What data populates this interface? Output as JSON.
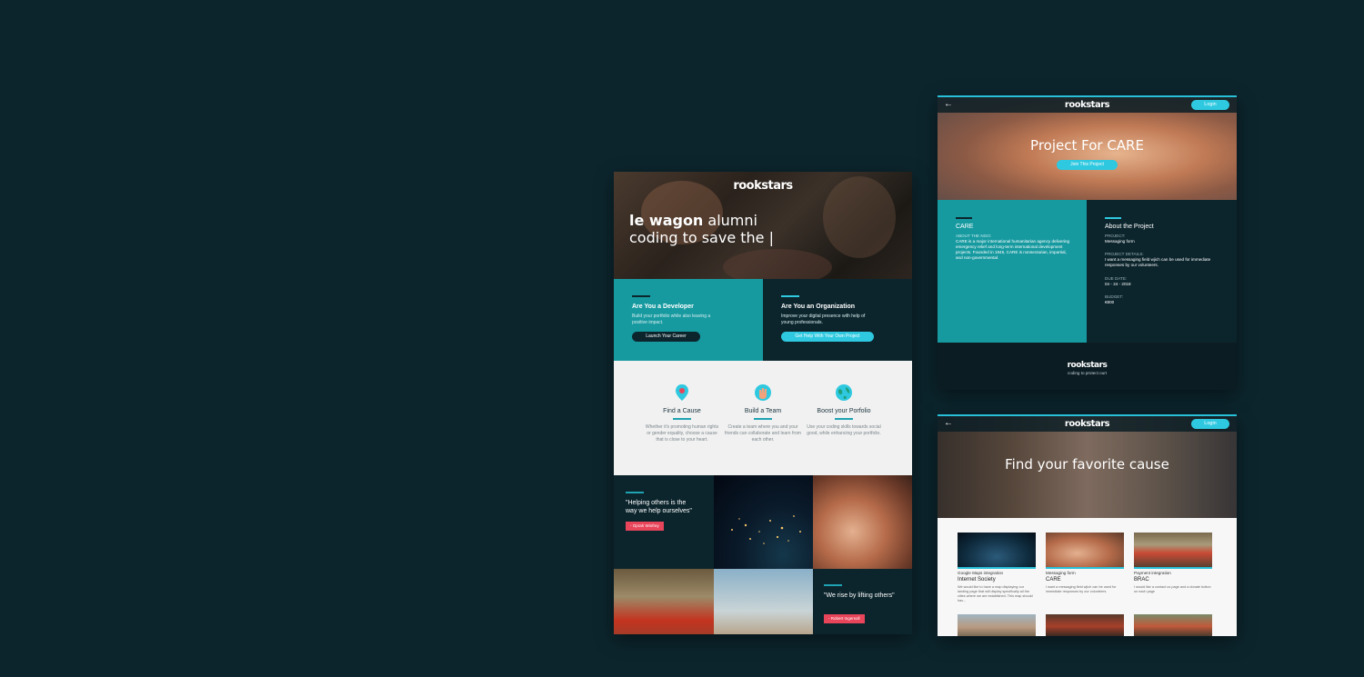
{
  "brand": {
    "logo_text": "rookstars",
    "tagline": "coding to protect ourt"
  },
  "colors": {
    "background": "#0c252d",
    "teal": "#169aa0",
    "cyan": "#2ec9e0",
    "pink": "#e8445a",
    "dark_navy": "#0c252d"
  },
  "landing": {
    "hero_bold": "le wagon",
    "hero_rest": " alumni",
    "hero_line2": "coding to save the |",
    "developer": {
      "title": "Are You a Developer",
      "desc": "Build your portfolio while also leaving a positive impact.",
      "button": "Launch Your Career"
    },
    "organization": {
      "title": "Are You an Organization",
      "desc": "Improve your digital presence with help of young professionals.",
      "button": "Get Help With Your Own Project"
    },
    "features": [
      {
        "icon": "map-pin-icon",
        "title": "Find a Cause",
        "desc": "Whether it's promoting human rights or gender equality, choose a cause that is close to your heart."
      },
      {
        "icon": "hand-icon",
        "title": "Build a Team",
        "desc": "Create a team where you and your friends can collaborate and learn from each other."
      },
      {
        "icon": "globe-icon",
        "title": "Boost your Porfolio",
        "desc": "Use your coding skills towards social good, while enhancing your portfolio."
      }
    ],
    "quote1": {
      "text": "\"Helping others is the way we help ourselves\"",
      "author": "- Oprah Winfrey"
    },
    "quote2": {
      "text": "\"We rise by lifting others\"",
      "author": "- Robert Ingersoll"
    }
  },
  "project": {
    "title": "Project For CARE",
    "join_button": "Join This Project",
    "login_button": "Login",
    "ngo_name": "CARE",
    "about_ngo_label": "ABOUT THE NGO:",
    "about_ngo_text": "CARE is a major international humanitarian agency delivering emergency relief and long-term international development projects. Founded in 1945, CARE is nonsectarian, impartial, and non-governmental.",
    "about_project_title": "About the Project",
    "fields": [
      {
        "label": "PROJECT:",
        "value": "Messaging form"
      },
      {
        "label": "PROJECT DETAILS:",
        "value": "I want a messaging field wjich can be used for immediate responses by our volunteers."
      },
      {
        "label": "DUE DATE:",
        "value": "04 - 24 - 2018"
      },
      {
        "label": "BUDGET:",
        "value": "€800"
      }
    ]
  },
  "causes": {
    "title": "Find your favorite cause",
    "login_button": "Login",
    "cards": [
      {
        "subtitle": "Google Maps integration",
        "org": "Internet Society",
        "desc": "We would like to have a map displaying our landing page that will display specifically all the cities where we are established. This map should hav..."
      },
      {
        "subtitle": "Messaging form",
        "org": "CARE",
        "desc": "I want a messaging field wjich can be used for immediate responses by our volunteers."
      },
      {
        "subtitle": "Payment integration",
        "org": "BRAC",
        "desc": "I would like a contact us page and a donate button on each page"
      }
    ]
  }
}
